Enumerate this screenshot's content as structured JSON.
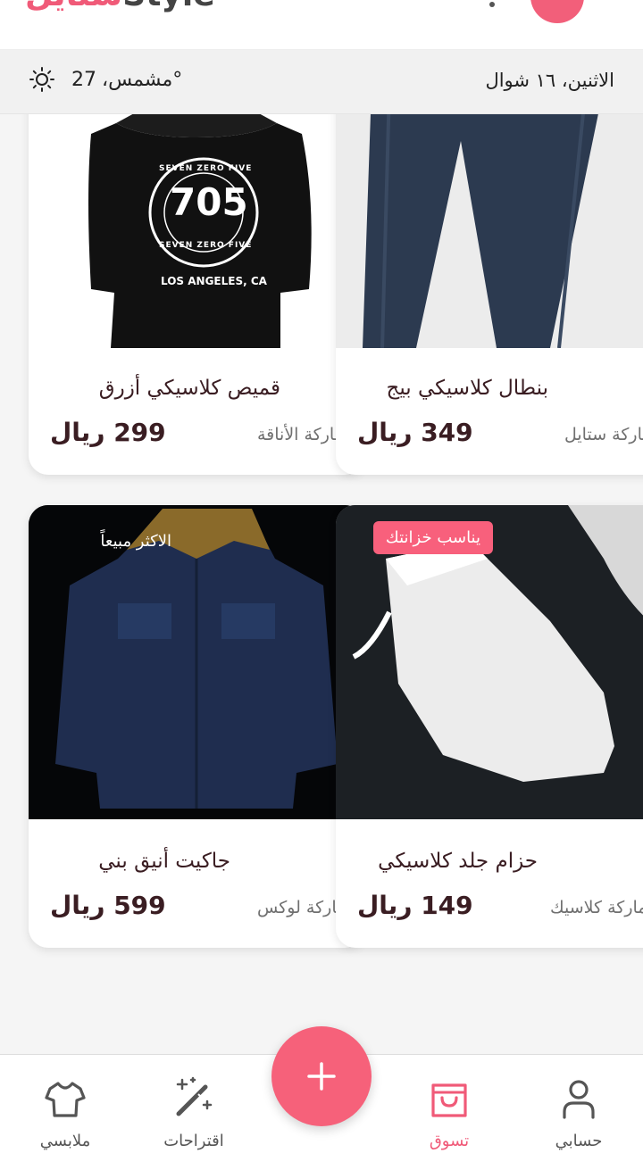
{
  "header": {
    "logo_colored": "ستايل",
    "logo_rest": "Style"
  },
  "info_bar": {
    "weather_icon": "sun-icon",
    "temperature": "27",
    "condition": "°مشمس،",
    "date": "الاثنين، ١٦ شوال"
  },
  "products": [
    {
      "name": "قميص كلاسيكي أزرق",
      "price": "299 ريال",
      "brand": "ماركة الأناقة",
      "badge": "",
      "image": "black-tshirt-photo"
    },
    {
      "name": "بنطال كلاسيكي بيج",
      "price": "349 ريال",
      "brand": "ماركة ستايل",
      "badge": "",
      "image": "jeans-photo"
    },
    {
      "name": "جاكيت أنيق بني",
      "price": "599 ريال",
      "brand": "ماركة لوكس",
      "badge": "الاكثر مبيعاً",
      "image": "denim-jacket-photo"
    },
    {
      "name": "حزام جلد كلاسيكي",
      "price": "149 ريال",
      "brand": "ماركة كلاسيك",
      "badge": "يناسب خزانتك",
      "image": "sneaker-photo"
    }
  ],
  "tshirt_print": {
    "top": "SEVEN ZERO FIVE",
    "number": "705",
    "bottom": "SEVEN ZERO FIVE",
    "city": "LOS ANGELES, CA"
  },
  "nav": {
    "wardrobe": "ملابسي",
    "suggestions": "اقتراحات",
    "shop": "تسوق",
    "account": "حسابي",
    "active": "shop",
    "fab_icon": "plus-icon"
  },
  "colors": {
    "accent": "#f05a78",
    "text_dark": "#3a1d22"
  }
}
